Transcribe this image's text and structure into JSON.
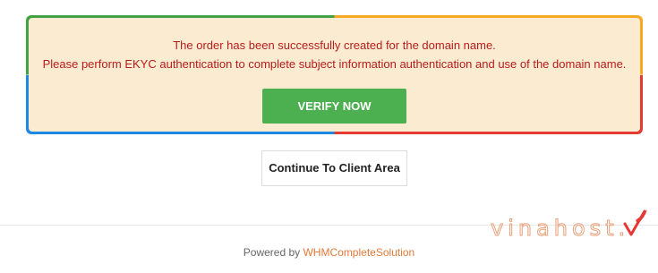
{
  "alert": {
    "line1": "The order has been successfully created for the domain name.",
    "line2": "Please perform EKYC authentication to complete subject information authentication and use of the domain name.",
    "verify_label": "VERIFY NOW"
  },
  "actions": {
    "continue_label": "Continue To Client Area"
  },
  "footer": {
    "powered_by": "Powered by ",
    "link_text": "WHMCompleteSolution"
  },
  "watermark": {
    "text": "vinahost.",
    "logo_icon": "checkmark-leaf-icon"
  },
  "colors": {
    "alert_bg": "#fbebd1",
    "alert_text": "#b71c1c",
    "verify_bg": "#4caf50",
    "link": "#e07a3a",
    "border_green": "#43a047",
    "border_yellow": "#f9a825",
    "border_blue": "#1e88e5",
    "border_red": "#e53935"
  }
}
